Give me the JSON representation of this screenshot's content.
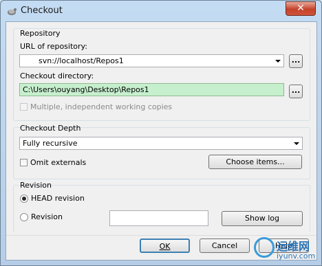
{
  "window": {
    "title": "Checkout",
    "close_label": "✕"
  },
  "repository": {
    "group_label": "Repository",
    "url_label": "URL of repository:",
    "url_value": "svn://localhost/Repos1",
    "browse_label": "...",
    "dir_label": "Checkout directory:",
    "dir_value": "C:\\Users\\ouyang\\Desktop\\Repos1",
    "dir_browse_label": "...",
    "multiple_label": "Multiple, independent working copies",
    "multiple_checked": false
  },
  "depth": {
    "group_label": "Checkout Depth",
    "selected": "Fully recursive",
    "omit_label": "Omit externals",
    "omit_checked": false,
    "choose_items_label": "Choose items..."
  },
  "revision": {
    "group_label": "Revision",
    "head_label": "HEAD revision",
    "head_selected": true,
    "revision_label": "Revision",
    "revision_value": "",
    "show_log_label": "Show log"
  },
  "footer": {
    "ok_label": "OK",
    "cancel_label": "Cancel",
    "help_label": "Help"
  },
  "watermark": {
    "text1": "运维网",
    "text2": "iyunv.com"
  },
  "colors": {
    "dir_highlight": "#c6efce",
    "title_bar": "#b9d1ea",
    "close_button": "#c7452e"
  }
}
